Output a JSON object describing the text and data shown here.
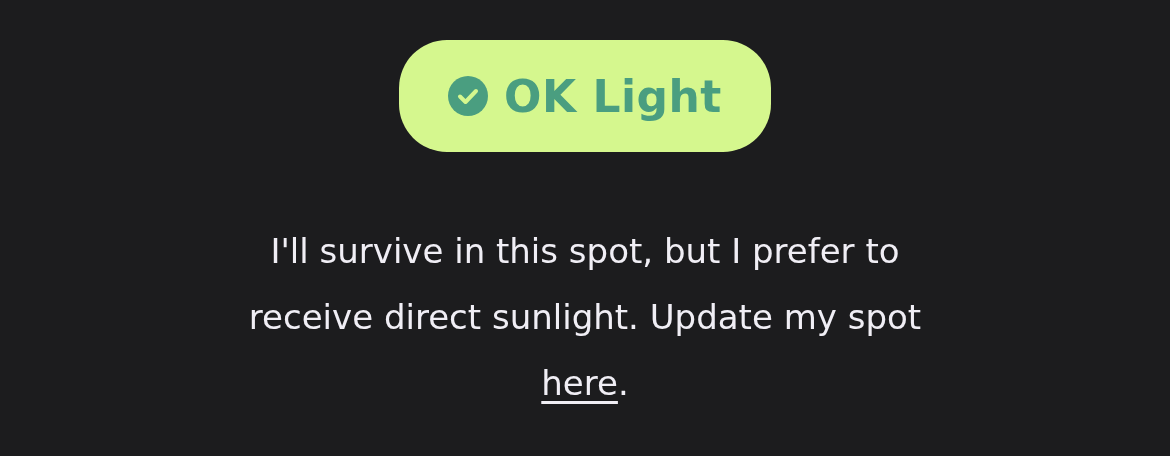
{
  "badge": {
    "label": "OK Light"
  },
  "message": {
    "text": "I'll survive in this spot, but I prefer to receive direct sunlight. Update my spot ",
    "link": "here",
    "end": "."
  }
}
